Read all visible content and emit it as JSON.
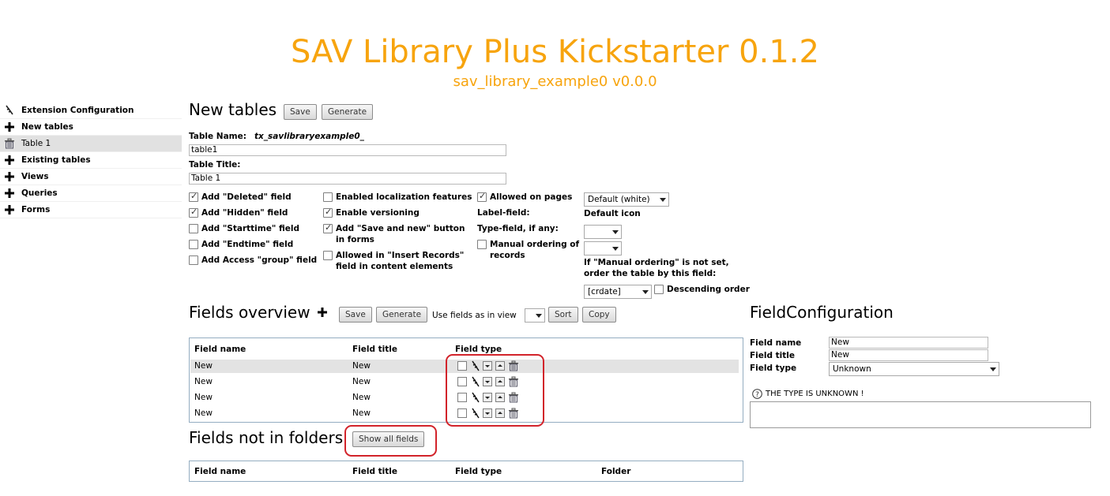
{
  "header": {
    "title": "SAV Library Plus Kickstarter 0.1.2",
    "subtitle": "sav_library_example0 v0.0.0",
    "color": "#f7a40e"
  },
  "sidebar": {
    "items": [
      {
        "label": "Extension Configuration",
        "icon": "feather-icon"
      },
      {
        "label": "New tables",
        "icon": "plus-icon"
      },
      {
        "label": "Table 1",
        "icon": "trash-icon",
        "active": true
      },
      {
        "label": "Existing tables",
        "icon": "plus-icon"
      },
      {
        "label": "Views",
        "icon": "plus-icon"
      },
      {
        "label": "Queries",
        "icon": "plus-icon"
      },
      {
        "label": "Forms",
        "icon": "plus-icon"
      }
    ]
  },
  "new_tables": {
    "heading": "New tables",
    "save_label": "Save",
    "generate_label": "Generate",
    "table_name_label": "Table Name:",
    "table_name_prefix": "tx_savlibraryexample0_",
    "table_name_value": "table1",
    "table_title_label": "Table Title:",
    "table_title_value": "Table 1",
    "options_col1": [
      {
        "label": "Add \"Deleted\" field",
        "checked": true
      },
      {
        "label": "Add \"Hidden\" field",
        "checked": true
      },
      {
        "label": "Add \"Starttime\" field",
        "checked": false
      },
      {
        "label": "Add \"Endtime\" field",
        "checked": false
      },
      {
        "label": "Add Access \"group\" field",
        "checked": false
      }
    ],
    "options_col2": [
      {
        "label": "Enabled localization features",
        "checked": false
      },
      {
        "label": "Enable versioning",
        "checked": true
      },
      {
        "label": "Add \"Save and new\" button in forms",
        "checked": true
      },
      {
        "label": "Allowed in \"Insert Records\" field in content elements",
        "checked": false
      }
    ],
    "allowed_on_pages_label": "Allowed on pages",
    "allowed_on_pages_checked": true,
    "label_field_label": "Label-field:",
    "type_field_label": "Type-field, if any:",
    "manual_ordering_label": "Manual ordering of records",
    "manual_ordering_checked": false,
    "default_select_value": "Default (white)",
    "default_icon_label": "Default icon",
    "order_note": "If \"Manual ordering\" is not set, order the table by this field:",
    "order_field_value": "[crdate]",
    "descending_label": "Descending order",
    "descending_checked": false
  },
  "fields_overview": {
    "heading": "Fields overview",
    "save_label": "Save",
    "generate_label": "Generate",
    "use_fields_label": "Use fields as in view",
    "use_fields_value": "",
    "sort_label": "Sort",
    "copy_label": "Copy",
    "columns": [
      "Field name",
      "Field title",
      "Field type"
    ],
    "rows": [
      {
        "name": "New",
        "title": "New",
        "selected": true
      },
      {
        "name": "New",
        "title": "New",
        "selected": false
      },
      {
        "name": "New",
        "title": "New",
        "selected": false
      },
      {
        "name": "New",
        "title": "New",
        "selected": false
      }
    ]
  },
  "fields_not_in_folders": {
    "heading": "Fields not in folders",
    "show_all_label": "Show all fields",
    "columns": [
      "Field name",
      "Field title",
      "Field type",
      "Folder"
    ]
  },
  "field_configuration": {
    "heading": "FieldConfiguration",
    "field_name_label": "Field name",
    "field_name_value": "New",
    "field_title_label": "Field title",
    "field_title_value": "New",
    "field_type_label": "Field type",
    "field_type_value": "Unknown",
    "unknown_message": "THE TYPE IS UNKNOWN !"
  },
  "highlight_color": "#d2232a"
}
